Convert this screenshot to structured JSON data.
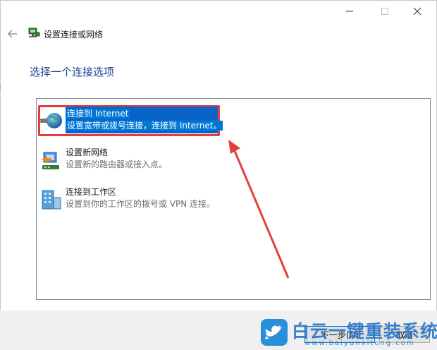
{
  "window": {
    "title": "设置连接或网络",
    "minimize_icon": "minimize-icon",
    "maximize_icon": "maximize-icon",
    "close_icon": "close-icon",
    "back_icon": "back-arrow-icon"
  },
  "main": {
    "heading": "选择一个连接选项",
    "options": [
      {
        "title": "连接到 Internet",
        "description": "设置宽带或拨号连接，连接到 Internet。",
        "icon": "globe-connect-icon",
        "selected": true
      },
      {
        "title": "设置新网络",
        "description": "设置新的路由器或接入点。",
        "icon": "router-setup-icon",
        "selected": false
      },
      {
        "title": "连接到工作区",
        "description": "设置到你的工作区的拨号或 VPN 连接。",
        "icon": "workplace-vpn-icon",
        "selected": false
      }
    ]
  },
  "footer": {
    "next_label": "下一步(N)",
    "cancel_label": "取消"
  },
  "annotation": {
    "highlight_color": "#e43d3d"
  },
  "watermark": {
    "text": "白云一键重装系统",
    "url": "www.baiyunxitong.com"
  },
  "colors": {
    "heading": "#1f3f8f",
    "selection": "#0a64c8",
    "footer_bg": "#f0f0f0"
  }
}
